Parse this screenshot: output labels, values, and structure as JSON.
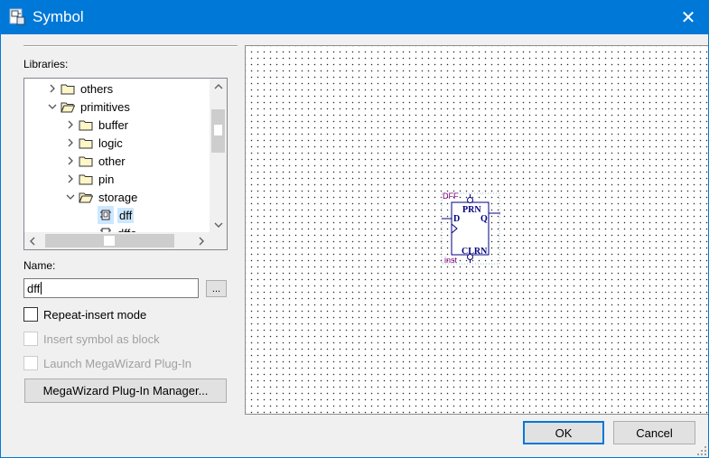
{
  "window": {
    "title": "Symbol",
    "icon": "symbol-app-icon",
    "close_glyph": "✕"
  },
  "libraries": {
    "label": "Libraries:",
    "items": [
      {
        "label": "others",
        "state": "collapsed",
        "level": 1
      },
      {
        "label": "primitives",
        "state": "expanded",
        "level": 1
      },
      {
        "label": "buffer",
        "state": "collapsed",
        "level": 2
      },
      {
        "label": "logic",
        "state": "collapsed",
        "level": 2
      },
      {
        "label": "other",
        "state": "collapsed",
        "level": 2
      },
      {
        "label": "pin",
        "state": "collapsed",
        "level": 2
      },
      {
        "label": "storage",
        "state": "expanded",
        "level": 2
      },
      {
        "label": "dff",
        "state": "leaf",
        "level": 3,
        "selected": true
      },
      {
        "label": "dffe",
        "state": "leaf",
        "level": 3
      }
    ]
  },
  "name": {
    "label": "Name:",
    "value": "dff",
    "browse_label": "..."
  },
  "options": {
    "repeat_insert": "Repeat-insert mode",
    "insert_as_block": "Insert symbol as block",
    "launch_megawizard": "Launch MegaWizard Plug-In"
  },
  "megawizard_button": "MegaWizard Plug-In Manager...",
  "preview": {
    "symbol_name": "DFF",
    "instance_name": "inst",
    "port_d": "D",
    "port_q": "Q",
    "port_prn": "PRN",
    "port_clrn": "CLRN"
  },
  "buttons": {
    "ok": "OK",
    "cancel": "Cancel"
  },
  "colors": {
    "titlebar": "#0078d7",
    "symbol_text": "#800080",
    "symbol_outline": "#000080",
    "selection": "#cce8ff"
  }
}
